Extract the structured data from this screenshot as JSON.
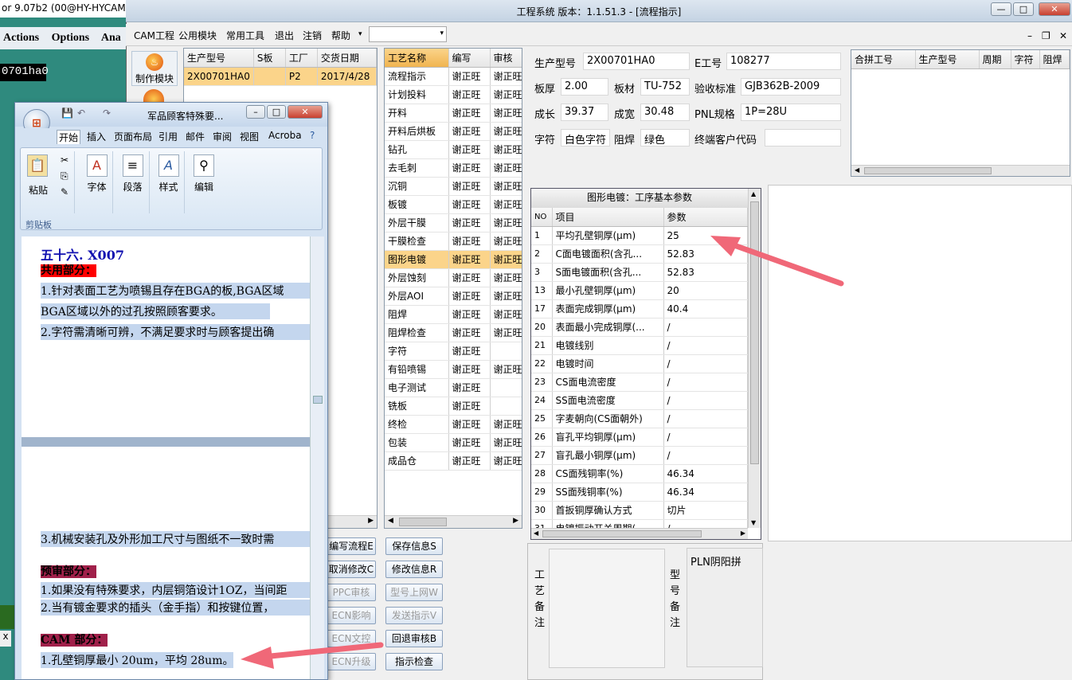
{
  "background_app": {
    "title": "or 9.07b2 (00@HY-HYCAM",
    "menu": [
      "Actions",
      "Options",
      "Ana"
    ],
    "field": "0701ha0",
    "x_label": "x"
  },
  "window": {
    "title": "工程系统  版本：1.1.51.3 - [流程指示]",
    "min": "—",
    "max": "□",
    "close": "✕"
  },
  "menu": [
    "CAM工程",
    "公用模块",
    "常用工具",
    "退出",
    "注销",
    "帮助"
  ],
  "nav": {
    "make": "制作模块"
  },
  "product_grid": {
    "headers": [
      "生产型号",
      "S板",
      "工厂",
      "交货日期"
    ],
    "rows": [
      [
        "2X00701HA0",
        "",
        "P2",
        "2017/4/28"
      ]
    ]
  },
  "process_grid": {
    "headers": [
      "工艺名称",
      "编写",
      "审核"
    ],
    "rows": [
      [
        "流程指示",
        "谢正旺",
        "谢正旺"
      ],
      [
        "计划投料",
        "谢正旺",
        "谢正旺"
      ],
      [
        "开料",
        "谢正旺",
        "谢正旺"
      ],
      [
        "开料后烘板",
        "谢正旺",
        "谢正旺"
      ],
      [
        "钻孔",
        "谢正旺",
        "谢正旺"
      ],
      [
        "去毛刺",
        "谢正旺",
        "谢正旺"
      ],
      [
        "沉铜",
        "谢正旺",
        "谢正旺"
      ],
      [
        "板镀",
        "谢正旺",
        "谢正旺"
      ],
      [
        "外层干膜",
        "谢正旺",
        "谢正旺"
      ],
      [
        "干膜检查",
        "谢正旺",
        "谢正旺"
      ],
      [
        "图形电镀",
        "谢正旺",
        "谢正旺"
      ],
      [
        "外层蚀刻",
        "谢正旺",
        "谢正旺"
      ],
      [
        "外层AOI",
        "谢正旺",
        "谢正旺"
      ],
      [
        "阻焊",
        "谢正旺",
        "谢正旺"
      ],
      [
        "阻焊检查",
        "谢正旺",
        "谢正旺"
      ],
      [
        "字符",
        "谢正旺",
        ""
      ],
      [
        "有铅喷锡",
        "谢正旺",
        "谢正旺"
      ],
      [
        "电子测试",
        "谢正旺",
        ""
      ],
      [
        "铣板",
        "谢正旺",
        ""
      ],
      [
        "终检",
        "谢正旺",
        "谢正旺"
      ],
      [
        "包装",
        "谢正旺",
        "谢正旺"
      ],
      [
        "成品仓",
        "谢正旺",
        "谢正旺"
      ]
    ],
    "highlight": "图形电镀"
  },
  "info": {
    "prod_model_label": "生产型号",
    "prod_model": "2X00701HA0",
    "e_no_label": "E工号",
    "e_no": "108277",
    "thickness_label": "板厚",
    "thickness": "2.00",
    "material_label": "板材",
    "material": "TU-752",
    "standard_label": "验收标准",
    "standard": "GJB362B-2009",
    "length_label": "成长",
    "length": "39.37",
    "width_label": "成宽",
    "width": "30.48",
    "pnl_label": "PNL规格",
    "pnl": "1P=28U",
    "legend_label": "字符",
    "legend": "白色字符",
    "mask_label": "阻焊",
    "mask": "绿色",
    "customer_label": "终端客户代码",
    "customer": ""
  },
  "merge_grid": {
    "headers": [
      "合拼工号",
      "生产型号",
      "周期",
      "字符",
      "阻焊"
    ]
  },
  "param_panel": {
    "caption": "图形电镀：工序基本参数",
    "headers": [
      "NO",
      "项目",
      "参数"
    ],
    "rows": [
      [
        "1",
        "平均孔壁铜厚(μm)",
        "25"
      ],
      [
        "2",
        "C面电镀面积(含孔...",
        "52.83"
      ],
      [
        "3",
        "S面电镀面积(含孔...",
        "52.83"
      ],
      [
        "13",
        "最小孔壁铜厚(μm)",
        "20"
      ],
      [
        "17",
        "表面完成铜厚(μm)",
        "40.4"
      ],
      [
        "20",
        "表面最小完成铜厚(...",
        "/"
      ],
      [
        "21",
        "电镀线别",
        "/"
      ],
      [
        "22",
        "电镀时间",
        "/"
      ],
      [
        "23",
        "CS面电流密度",
        "/"
      ],
      [
        "24",
        "SS面电流密度",
        "/"
      ],
      [
        "25",
        "字麦朝向(CS面朝外)",
        "/"
      ],
      [
        "26",
        "盲孔平均铜厚(μm)",
        "/"
      ],
      [
        "27",
        "盲孔最小铜厚(μm)",
        "/"
      ],
      [
        "28",
        "CS面残铜率(%)",
        "46.34"
      ],
      [
        "29",
        "SS面残铜率(%)",
        "46.34"
      ],
      [
        "30",
        "首扳铜厚确认方式",
        "切片"
      ],
      [
        "31",
        "电镀振动开关周期(...",
        "/"
      ]
    ]
  },
  "remarks": {
    "process_label": "工艺备注",
    "model_label": "型号备注",
    "model_value": "PLN阴阳拼"
  },
  "actions": {
    "left": [
      "编写流程E",
      "取消修改C",
      "PPC审核",
      "ECN影响",
      "ECN文控",
      "ECN升级"
    ],
    "right": [
      "保存信息S",
      "修改信息R",
      "型号上网W",
      "发送指示V",
      "回退审核B",
      "指示检查"
    ]
  },
  "word": {
    "title": "军品顾客特殊要...",
    "tabs": [
      "开始",
      "插入",
      "页面布局",
      "引用",
      "邮件",
      "审阅",
      "视图",
      "Acroba"
    ],
    "groups": [
      "粘贴",
      "字体",
      "段落",
      "样式",
      "编辑"
    ],
    "clipboard": "剪贴板",
    "doc_lines": [
      "五十六. X007",
      "共用部分：",
      "1.针对表面工艺为喷锡且存在BGA的板,BGA区域",
      "BGA区域以外的过孔按照顾客要求。",
      "2.字符需清晰可辨，不满足要求时与顾客提出确",
      "3.机械安装孔及外形加工尺寸与图纸不一致时需",
      "预审部分：",
      "1.如果没有特殊要求，内层铜箔设计1OZ，当间距",
      "2.当有镀金要求的插头（金手指）和按键位置，",
      "CAM 部分：",
      "1.孔壁铜厚最小 20um，平均 28um。"
    ]
  }
}
